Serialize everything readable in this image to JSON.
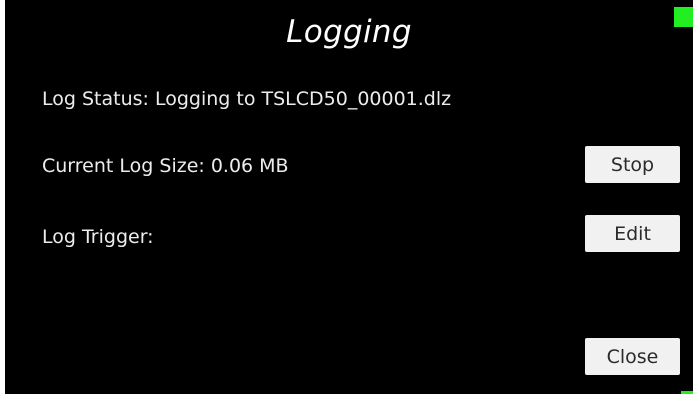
{
  "screen": {
    "title": "Logging",
    "indicator_color": "#22ee22"
  },
  "log_status": {
    "label": "Log Status:  Logging to TSLCD50_00001.dlz"
  },
  "log_size": {
    "label": "Current Log Size: 0.06 MB"
  },
  "log_trigger": {
    "label": "Log Trigger:"
  },
  "buttons": {
    "stop": "Stop",
    "edit": "Edit",
    "close": "Close"
  }
}
